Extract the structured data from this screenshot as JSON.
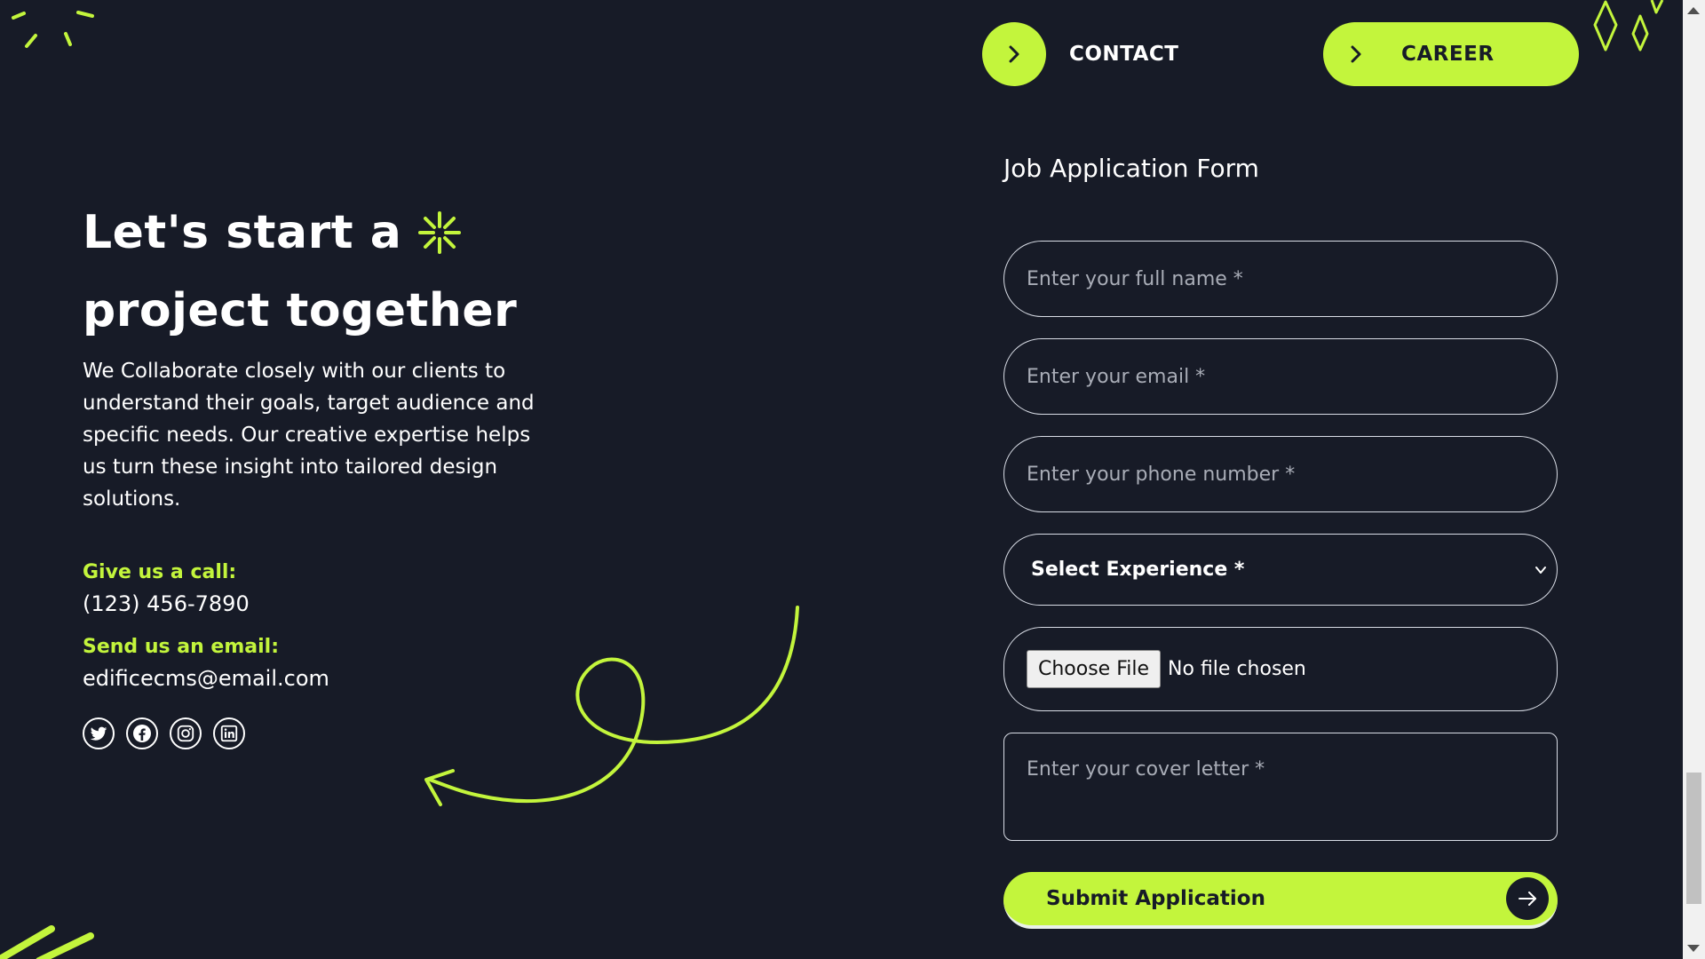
{
  "nav": {
    "contact_label": "CONTACT",
    "career_label": "CAREER"
  },
  "hero": {
    "headline_line1": "Let's start a",
    "headline_line2": "project together",
    "intro": "We Collaborate closely with our clients to understand their goals, target audience and specific needs. Our creative expertise helps us turn these insight into tailored design solutions."
  },
  "contact": {
    "call_label": "Give us a call:",
    "phone": "(123) 456-7890",
    "email_label": "Send us an email:",
    "email": "edificecms@email.com"
  },
  "socials": [
    {
      "icon": "twitter-icon"
    },
    {
      "icon": "facebook-icon"
    },
    {
      "icon": "instagram-icon"
    },
    {
      "icon": "linkedin-icon"
    }
  ],
  "form": {
    "title": "Job Application Form",
    "full_name_placeholder": "Enter your full name *",
    "email_placeholder": "Enter your email *",
    "phone_placeholder": "Enter your phone number *",
    "experience_selected": "Select Experience *",
    "file_button": "Choose File",
    "file_status": "No file chosen",
    "cover_letter_placeholder": "Enter your cover letter *",
    "submit_label": "Submit Application"
  },
  "colors": {
    "accent": "#c3f53c",
    "background": "#171b27",
    "text": "#ffffff"
  }
}
